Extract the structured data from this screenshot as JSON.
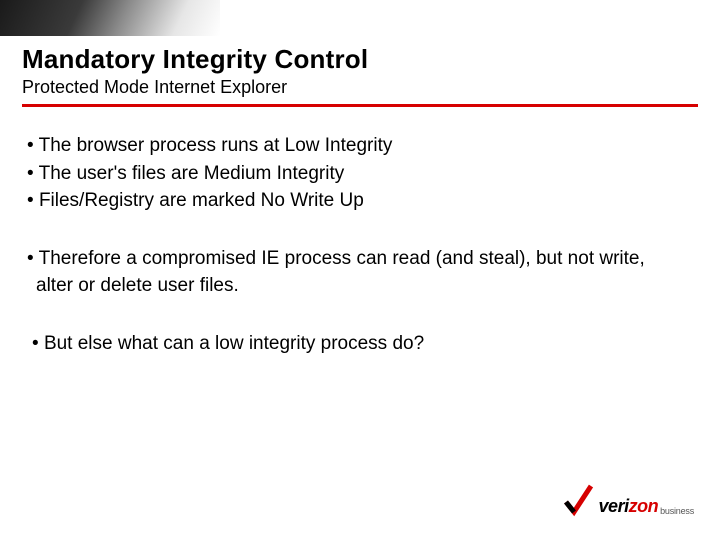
{
  "title": "Mandatory Integrity Control",
  "subtitle": "Protected Mode Internet Explorer",
  "groups": [
    {
      "lines": [
        "The browser process runs at Low Integrity",
        "The user's files are Medium Integrity",
        "Files/Registry are marked No Write Up"
      ]
    },
    {
      "lines": [
        "Therefore a compromised IE process can read (and steal), but not write, alter or delete user files."
      ]
    },
    {
      "lines": [
        " But else what can a low integrity process do?"
      ]
    }
  ],
  "logo": {
    "part1": "veri",
    "part2": "zon",
    "suffix": "business"
  },
  "colors": {
    "brand_red": "#d60000"
  }
}
